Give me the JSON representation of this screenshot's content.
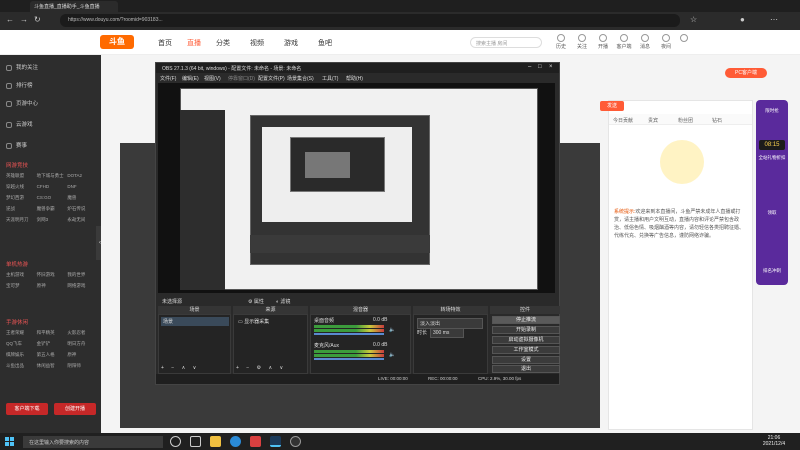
{
  "browser": {
    "tab_title": "斗鱼直播_直播助手_斗鱼直播",
    "url": "https://www.douyu.com/?roomid=903183..."
  },
  "site": {
    "logo_text": "斗鱼",
    "nav": [
      "首页",
      "直播",
      "分类",
      "视频",
      "游戏",
      "鱼吧"
    ],
    "search_placeholder": "搜索主播 房间",
    "header_icons": [
      "历史",
      "关注",
      "开播",
      "客户端",
      "消息",
      "夜间"
    ]
  },
  "sidebar": {
    "items": [
      "我的关注",
      "排行榜",
      "页游中心",
      "云游戏",
      "赛事"
    ],
    "sections": [
      {
        "title": "网游竞技",
        "games": [
          "英雄联盟",
          "地下城与勇士",
          "DOTA2",
          "穿越火线",
          "CFHD",
          "DNF",
          "梦幻西游",
          "CS:GO",
          "魔兽",
          "逆战",
          "魔兽争霸",
          "炉石传说",
          "天涯明月刀",
          "剑网3",
          "永劫无间"
        ]
      },
      {
        "title": "单机热游",
        "games": [
          "主机游戏",
          "怀旧游戏",
          "我的世界",
          "宝可梦",
          "原神",
          "网络游戏"
        ]
      },
      {
        "title": "手游休闲",
        "games": [
          "王者荣耀",
          "和平精英",
          "火影忍者",
          "QQ飞车",
          "金铲铲",
          "明日方舟",
          "棋牌娱乐",
          "第五人格",
          "原神",
          "斗鱼出品",
          "休闲益智",
          "阴阳师"
        ]
      }
    ],
    "bottom_buttons": [
      "客户端下载",
      "创建开播"
    ]
  },
  "page": {
    "pc_button": "PC客户端",
    "tabs": [
      "今日贡献",
      "贵宾",
      "粉丝团",
      "钻石"
    ],
    "send_button": "发送",
    "chat_text": "欢迎来到本直播间，斗鱼严禁未成年人直播或打赏，请主播和用户文明互动，直播内容和评论严禁包含政治、低俗色情、吸烟酗酒等内容，请勿轻信各类招聘征婚、代练代充、兑换等广告信息，谨防网络诈骗。",
    "chat_prefix": "系统提示:",
    "promo_timer": "08:15",
    "promo_texts": [
      "限时抢",
      "全站礼物折扣",
      "领取",
      "排名冲刺"
    ]
  },
  "obs": {
    "title": "OBS 27.1.3 (64 bit, windows) - 配置文件: 未命名 - 场景: 未命名",
    "menu": [
      "文件(F)",
      "编辑(E)",
      "视图(V)",
      "停靠窗口(D)",
      "配置文件(P)",
      "场景集合(S)",
      "工具(T)",
      "帮助(H)"
    ],
    "scene_bar": "未选择源",
    "scene_bar_buttons": [
      "属性",
      "滤镜"
    ],
    "docks": {
      "scenes": {
        "title": "场景",
        "items": [
          "场景"
        ]
      },
      "sources": {
        "title": "来源",
        "items": [
          "显示器采集"
        ]
      },
      "mixer": {
        "title": "混音器",
        "channels": [
          {
            "name": "桌面音频",
            "level": "0.0 dB"
          },
          {
            "name": "麦克风/Aux",
            "level": "0.0 dB"
          }
        ]
      },
      "transitions": {
        "title": "转场特效",
        "type": "淡入淡出",
        "duration_label": "时长",
        "duration": "300 ms"
      },
      "controls": {
        "title": "控件",
        "buttons": [
          "停止推流",
          "开始录制",
          "启动虚拟摄像机",
          "工作室模式",
          "设置",
          "退出"
        ]
      }
    },
    "status": {
      "live": "LIVE: 00:00:00",
      "rec": "REC: 00:00:00",
      "cpu": "CPU: 2.9%, 30.00 fps"
    }
  },
  "taskbar": {
    "search_placeholder": "在这里输入你要搜索的内容",
    "time": "21:06",
    "date": "2021/12/4"
  }
}
